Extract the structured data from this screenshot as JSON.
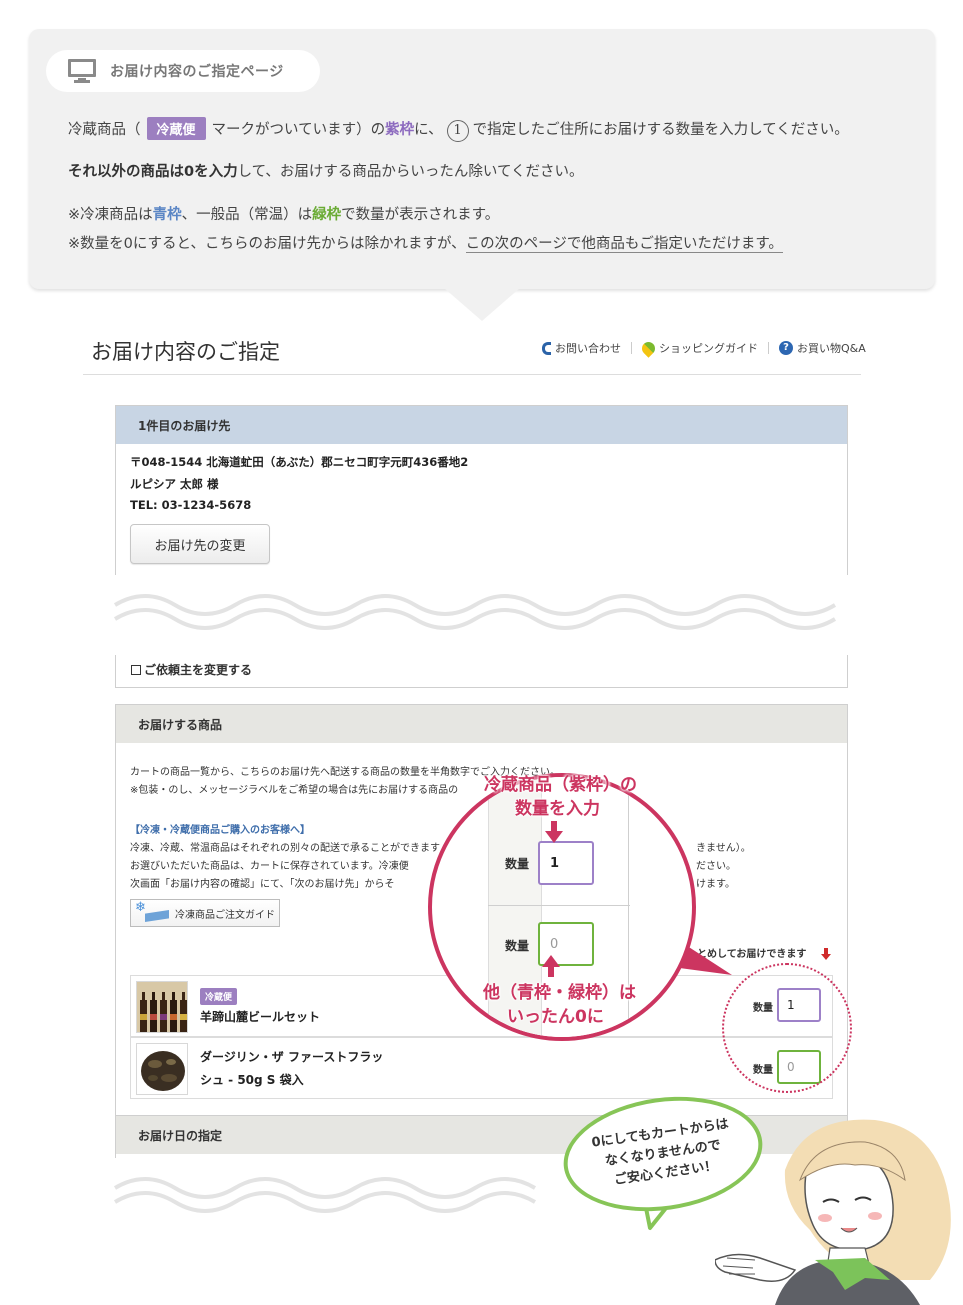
{
  "info": {
    "tag": "お届け内容のご指定ページ",
    "line1": {
      "pre": "冷蔵商品（",
      "badge": "冷蔵便",
      "mid": "マークがついています）の",
      "purple": "紫枠",
      "post1": "に、",
      "circled": "1",
      "post2": "で指定したご住所にお届けする数量を入力してください。"
    },
    "line2": {
      "bold": "それ以外の商品は0を入力",
      "rest": "して、お届けする商品からいったん除いてください。"
    },
    "line3": {
      "pre": "※冷凍商品は",
      "blue": "青枠",
      "mid": "、一般品（常温）は",
      "green": "緑枠",
      "post": "で数量が表示されます。"
    },
    "line4": {
      "pre": "※数量を0にすると、こちらのお届け先からは除かれますが、",
      "underlined": "この次のページで他商品もご指定いただけます。"
    }
  },
  "header": {
    "title": "お届け内容のご指定",
    "links": [
      "お問い合わせ",
      "ショッピングガイド",
      "お買い物Q&A"
    ],
    "help_glyph": "?"
  },
  "address_box": {
    "heading": "1件目のお届け先",
    "postal_address": "〒048-1544 北海道虻田（あぶた）郡ニセコ町字元町436番地2",
    "name": "ルピシア 太郎 様",
    "tel": "TEL: 03-1234-5678",
    "change_button": "お届け先の変更",
    "requester_checkbox": "ご依頼主を変更する"
  },
  "products_box": {
    "heading": "お届けする商品",
    "desc1": "カートの商品一覧から、こちらのお届け先へ配送する商品の数量を半角数字でご入力ください。",
    "desc2": "※包装・のし、メッセージラベルをご希望の場合は先にお届けする商品の",
    "frozen_title": "【冷凍・冷蔵便商品ご購入のお客様へ】",
    "frozen1": "冷凍、冷蔵、常温商品はそれぞれの別々の配送で承ることができます",
    "frozen1_tail": "きません）。",
    "frozen2": "お選びいただいた商品は、カートに保存されています。冷凍便",
    "frozen2_tail": "ださい。",
    "frozen3": "次画面「お届け内容の確認」にて、「次のお届け先」からそ",
    "frozen3_tail": "けます。",
    "guide_button": "冷凍商品ご注文ガイド",
    "combine_note": "とめしてお届けできます",
    "items": [
      {
        "badge": "冷蔵便",
        "name": "羊蹄山麓ビールセット",
        "qty_label": "数量",
        "qty": "1"
      },
      {
        "name_line1": "ダージリン・ザ ファーストフラッ",
        "name_line2": "シュ - 50g S 袋入",
        "qty_label": "数量",
        "qty": "0"
      }
    ]
  },
  "delivery_date_box": {
    "heading": "お届け日の指定"
  },
  "zoom": {
    "top_text_line1": "冷蔵商品（紫枠）の",
    "top_text_line2": "数量を入力",
    "bottom_text_line1": "他（青枠・緑枠）は",
    "bottom_text_line2": "いったん0に",
    "qty_label": "数量",
    "qty1": "1",
    "qty2": "0"
  },
  "speech": {
    "line1": "0にしてもカートからは",
    "line2": "なくなりませんので",
    "line3": "ご安心ください！"
  },
  "colors": {
    "purple": "#9c7fc0",
    "green": "#6fb33d",
    "blue": "#5b86c5",
    "accent_red": "#cc3560",
    "panel_bg": "#f1f1f1"
  }
}
